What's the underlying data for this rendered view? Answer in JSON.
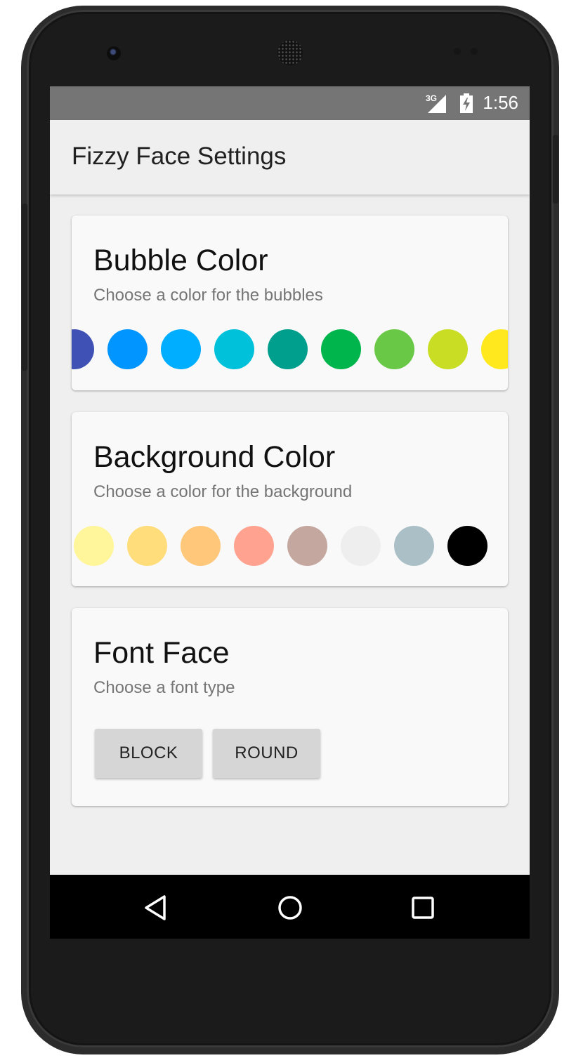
{
  "status_bar": {
    "network": "3G",
    "time": "1:56"
  },
  "app_bar": {
    "title": "Fizzy Face Settings"
  },
  "bubble_card": {
    "title": "Bubble Color",
    "subtitle": "Choose a color for the bubbles",
    "colors": [
      "#3F51B5",
      "#0095FF",
      "#00AEFF",
      "#00C1DA",
      "#009E8C",
      "#00B64C",
      "#69C845",
      "#C8DD23",
      "#FFE91E"
    ]
  },
  "background_card": {
    "title": "Background Color",
    "subtitle": "Choose a color for the background",
    "colors": [
      "#FFF59B",
      "#FFDD7B",
      "#FFC77A",
      "#FFA390",
      "#C4A79F",
      "#EEEEEE",
      "#ABBFC7",
      "#000000"
    ]
  },
  "font_card": {
    "title": "Font Face",
    "subtitle": "Choose a font type",
    "buttons": [
      "BLOCK",
      "ROUND"
    ]
  },
  "nav_bar": {
    "icons": [
      "back-icon",
      "home-icon",
      "recents-icon"
    ]
  }
}
